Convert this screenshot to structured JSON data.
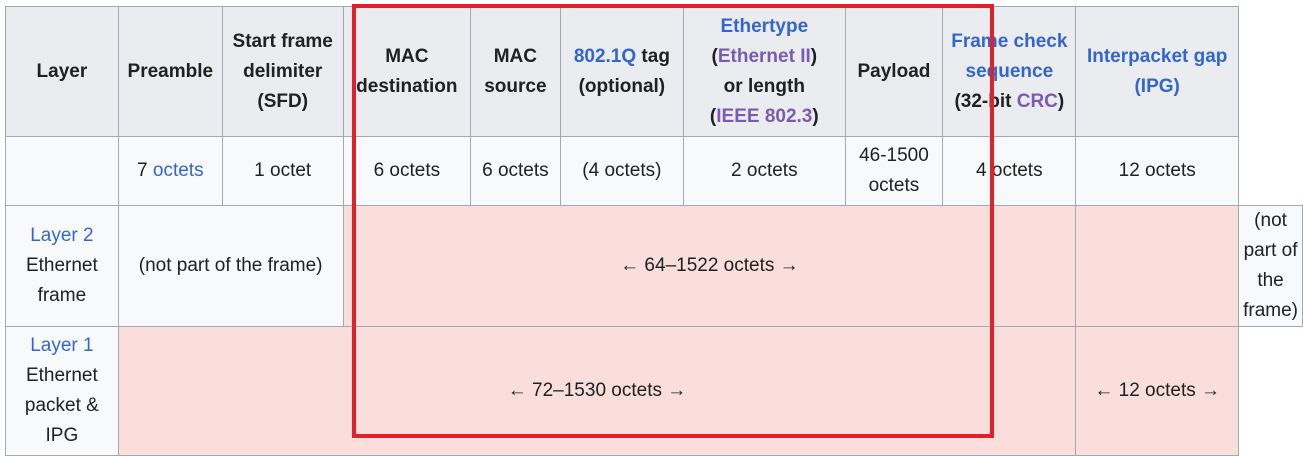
{
  "headers": {
    "layer": "Layer",
    "preamble": "Preamble",
    "sfd": [
      "Start frame",
      "delimiter",
      "(SFD)"
    ],
    "mac_dest": [
      "MAC",
      "destination"
    ],
    "mac_src": [
      "MAC",
      "source"
    ],
    "q_link": "802.1Q",
    "q_rest1": " tag",
    "q_rest2": "(optional)",
    "ethertype_link": "Ethertype",
    "paren_open": "(",
    "ethernet2_link": "Ethernet II",
    "paren_close": ")",
    "or_length": "or length",
    "ieee_link": "IEEE 802.3",
    "payload": "Payload",
    "fcs_link": [
      "Frame check",
      "sequence"
    ],
    "fcs_rest_pre": "(32-bit ",
    "crc_link": "CRC",
    "fcs_rest_post": ")",
    "ipg_link": [
      "Interpacket gap",
      "(IPG)"
    ]
  },
  "size_row": {
    "layer": "",
    "preamble_num": "7 ",
    "preamble_link": "octets",
    "sfd": "1 octet",
    "mac_dest": "6 octets",
    "mac_src": "6 octets",
    "q_tag": "(4 octets)",
    "ethertype": "2 octets",
    "payload": [
      "46-1500",
      "octets"
    ],
    "fcs": "4 octets",
    "ipg": "12 octets"
  },
  "layer2_row": {
    "layer_link": "Layer 2",
    "layer_text": [
      "Ethernet",
      "frame"
    ],
    "not_part_left": "(not part of the frame)",
    "frame_span": "← 64–1522 octets →",
    "not_part_right": [
      "(not part of the",
      "frame)"
    ]
  },
  "layer1_row": {
    "layer_link": "Layer 1",
    "layer_text": [
      "Ethernet",
      "packet &",
      "IPG"
    ],
    "packet_span": "← 72–1530 octets →",
    "ipg_span": "← 12 octets →"
  },
  "colors": {
    "header_bg": "#eaecf0",
    "cell_bg": "#f8f9fa",
    "frame_bg": "#f9dedc",
    "link": "#3366cc",
    "visited_link": "#795cb2",
    "highlight_border": "#e0202a"
  }
}
